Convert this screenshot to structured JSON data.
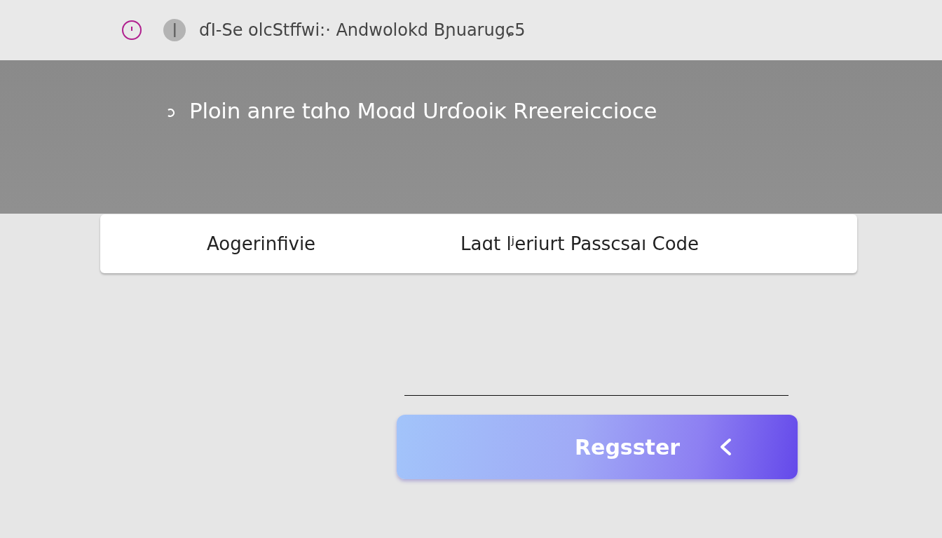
{
  "top_bar": {
    "title": "ɗI-Se olcStffwi:· Andwolokd Bɲuarugɕ5"
  },
  "banner": {
    "heading": "Ploin  anre tɑho Moɑd Urɗooiĸ Rreereiccioce"
  },
  "card": {
    "label": "Aogerinfivie",
    "value": "Laɑt lʲeriurt Passcsaı Code"
  },
  "button": {
    "label": "Regsster"
  }
}
